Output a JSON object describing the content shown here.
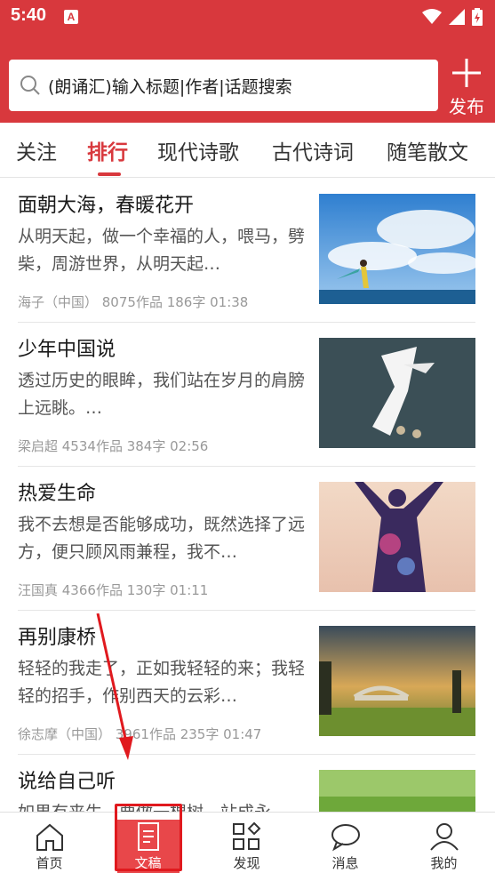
{
  "status_bar": {
    "time": "5:40",
    "notification_icon": "A"
  },
  "search": {
    "placeholder": "(朗诵汇)输入标题|作者|话题搜索"
  },
  "publish": {
    "label": "发布"
  },
  "tabs": [
    {
      "label": "关注",
      "active": false
    },
    {
      "label": "排行",
      "active": true
    },
    {
      "label": "现代诗歌",
      "active": false
    },
    {
      "label": "古代诗词",
      "active": false
    },
    {
      "label": "随笔散文",
      "active": false
    }
  ],
  "articles": [
    {
      "title": "面朝大海，春暖花开",
      "excerpt": "从明天起，做一个幸福的人，喂马，劈柴，周游世界，从明天起…",
      "meta": "海子（中国）  8075作品  186字 01:38",
      "image": "sky-sea-person"
    },
    {
      "title": "少年中国说",
      "excerpt": "透过历史的眼眸，我们站在岁月的肩膀上远眺。…",
      "meta": "梁启超  4534作品  384字 02:56",
      "image": "calligraphy-poster"
    },
    {
      "title": "热爱生命",
      "excerpt": "我不去想是否能够成功，既然选择了远方，便只顾风雨兼程，我不…",
      "meta": "汪国真  4366作品  130字 01:11",
      "image": "galaxy-silhouette"
    },
    {
      "title": "再别康桥",
      "excerpt": "轻轻的我走了，正如我轻轻的来；我轻轻的招手，作别西天的云彩…",
      "meta": "徐志摩（中国）  3961作品  235字 01:47",
      "image": "bridge-sunset"
    },
    {
      "title": "说给自己听",
      "excerpt": "如果有来生，要做一棵树，站成永…",
      "meta": "",
      "image": "green-meadow"
    }
  ],
  "bottom_nav": [
    {
      "label": "首页",
      "icon": "home-icon",
      "active": false
    },
    {
      "label": "文稿",
      "icon": "document-icon",
      "active": true
    },
    {
      "label": "发现",
      "icon": "discover-icon",
      "active": false
    },
    {
      "label": "消息",
      "icon": "message-icon",
      "active": false
    },
    {
      "label": "我的",
      "icon": "profile-icon",
      "active": false
    }
  ],
  "colors": {
    "brand_red": "#d8383d",
    "nav_active": "#e8474a"
  }
}
